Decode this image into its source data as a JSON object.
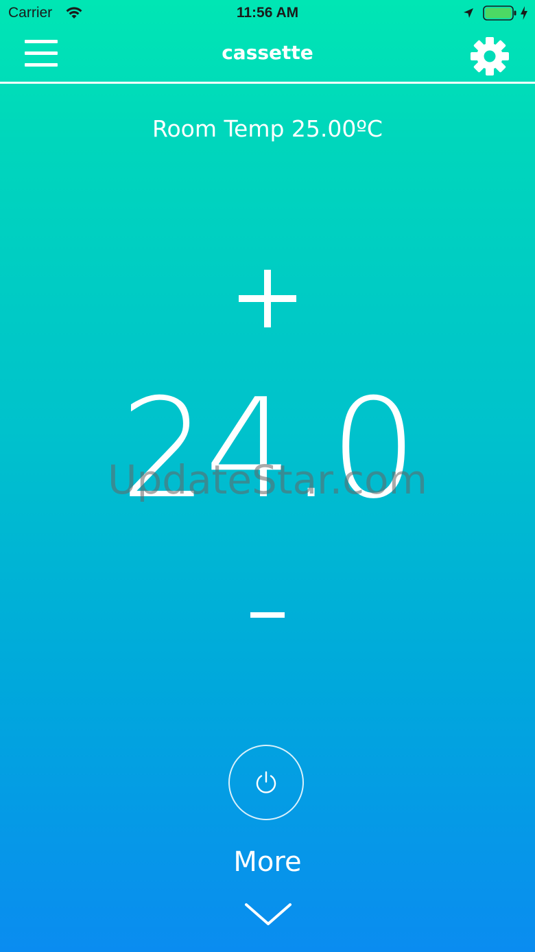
{
  "status_bar": {
    "carrier": "Carrier",
    "time": "11:56 AM",
    "battery_color": "#4cd964"
  },
  "nav": {
    "title": "cassette",
    "menu_icon": "hamburger-menu-icon",
    "settings_icon": "gear-icon"
  },
  "room_temp": {
    "label": "Room Temp 25.00ºC"
  },
  "thermostat": {
    "setpoint": "24.0",
    "increase_icon": "plus-icon",
    "decrease_icon": "minus-icon"
  },
  "watermark": "UpdateStar.com",
  "controls": {
    "power_icon": "power-icon",
    "more_label": "More",
    "more_icon": "chevron-down-icon"
  },
  "colors": {
    "gradient_top": "#00e6b4",
    "gradient_bottom": "#0a8cf0",
    "text": "#ffffff"
  }
}
